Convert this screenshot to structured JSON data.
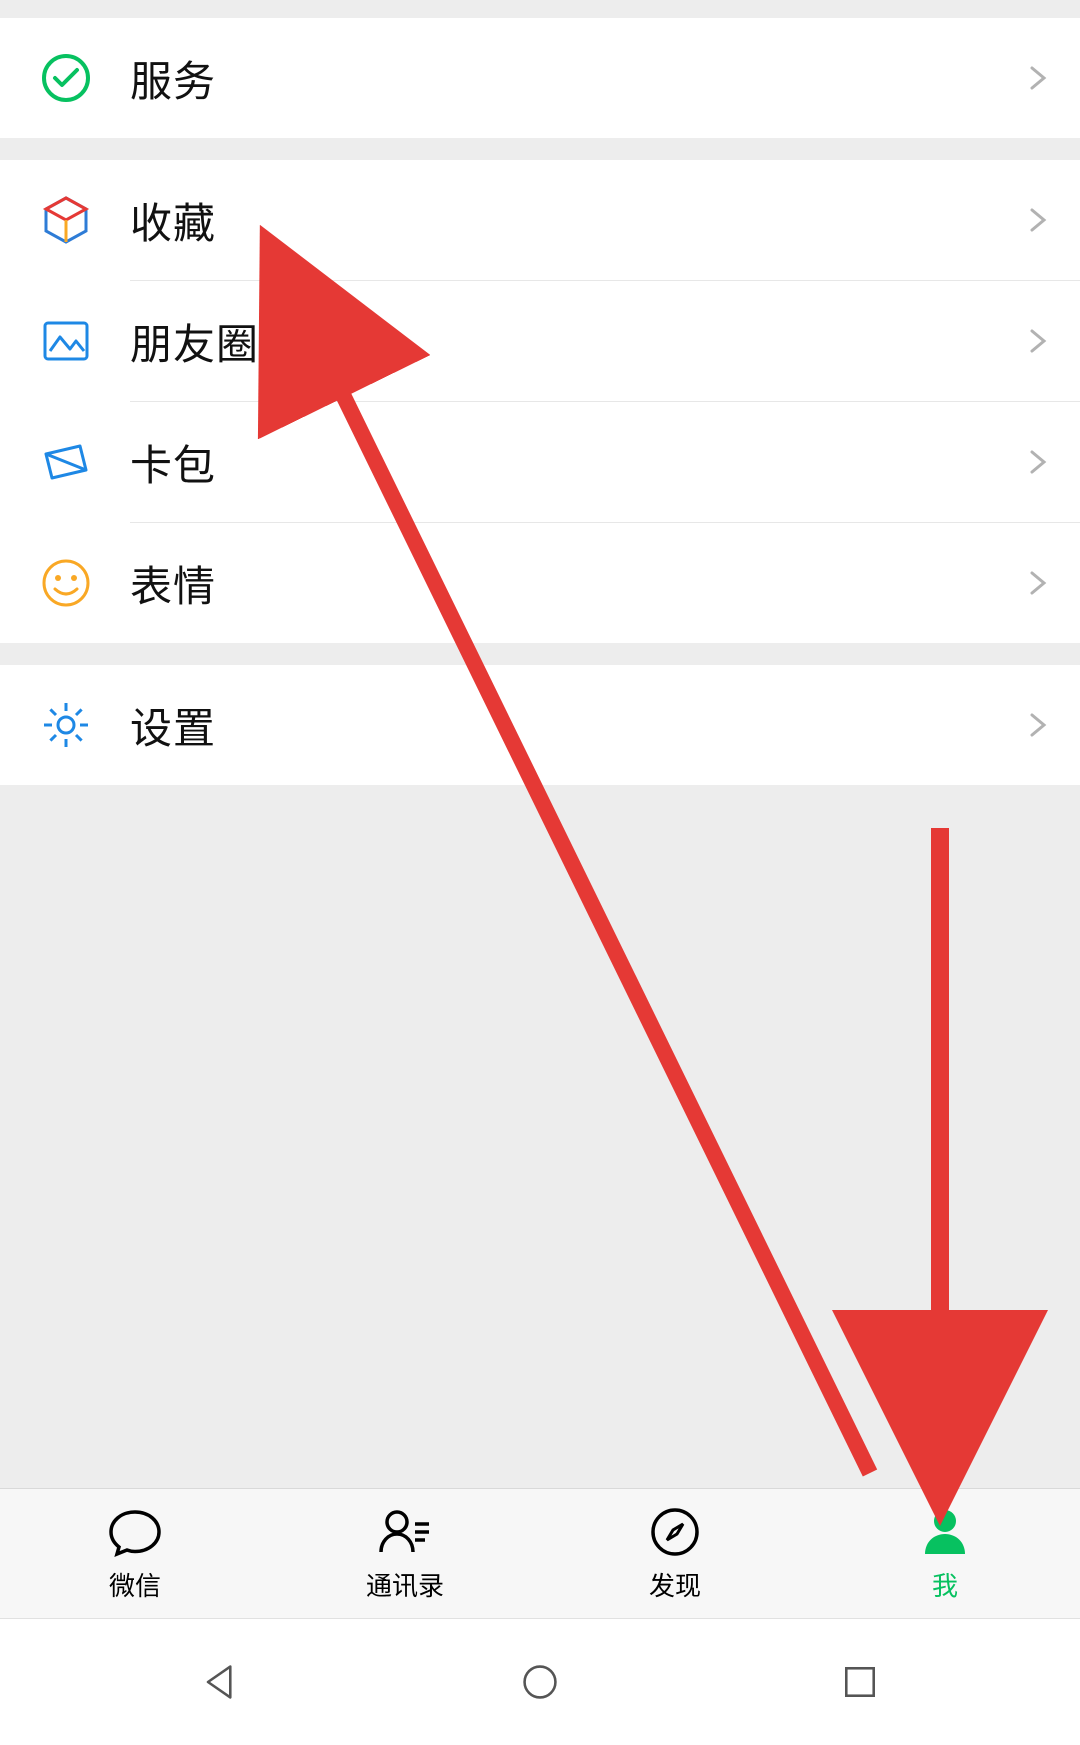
{
  "items": {
    "services": {
      "label": "服务"
    },
    "favorites": {
      "label": "收藏"
    },
    "moments": {
      "label": "朋友圈"
    },
    "cards": {
      "label": "卡包"
    },
    "stickers": {
      "label": "表情"
    },
    "settings": {
      "label": "设置"
    }
  },
  "tabs": {
    "chats": {
      "label": "微信"
    },
    "contacts": {
      "label": "通讯录"
    },
    "discover": {
      "label": "发现"
    },
    "me": {
      "label": "我"
    }
  },
  "colors": {
    "accent": "#07c160",
    "divider": "#e7e7e7",
    "bg": "#ededed"
  },
  "annotations": {
    "arrow_color": "#e53935"
  }
}
